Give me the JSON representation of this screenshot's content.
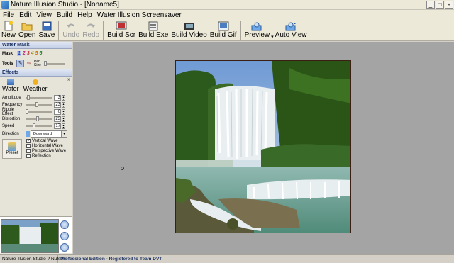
{
  "window": {
    "title": "Nature Illusion Studio - [Noname5]",
    "buttons": [
      "_",
      "□",
      "×"
    ]
  },
  "menu": [
    "File",
    "Edit",
    "View",
    "Build",
    "Help",
    "Water Illusion Screensaver"
  ],
  "toolbar": {
    "new": "New",
    "open": "Open",
    "save": "Save",
    "undo": "Undo",
    "redo": "Redo",
    "build_scr": "Build Scr",
    "build_exe": "Build Exe",
    "build_video": "Build Video",
    "build_gif": "Build Gif",
    "preview": "Preview",
    "auto_view": "Auto View"
  },
  "water_mask": {
    "header": "Water Mask",
    "mask_label": "Mask",
    "mask_numbers": [
      "1",
      "2",
      "3",
      "4",
      "5",
      "6"
    ],
    "tools_label": "Tools",
    "pen_size_label": "Pen Size"
  },
  "effects": {
    "header": "Effects",
    "tab_water": "Water",
    "tab_weather": "Weather",
    "params": [
      {
        "label": "Amplitude",
        "value": "3",
        "level": 0.05
      },
      {
        "label": "Frequency",
        "value": "23",
        "level": 0.4
      },
      {
        "label": "Ripple Effect",
        "value": "0",
        "level": 0.0
      },
      {
        "label": "Distortion",
        "value": "23",
        "level": 0.45
      },
      {
        "label": "Speed",
        "value": "17",
        "level": 0.3
      }
    ],
    "direction_label": "Direction",
    "direction_value": "Downward",
    "preset_label": "Preset",
    "checks": [
      {
        "label": "Vertical Wave",
        "checked": true
      },
      {
        "label": "Horizontal Wave",
        "checked": false
      },
      {
        "label": "Perspective Wave",
        "checked": false
      },
      {
        "label": "Reflection",
        "checked": false
      }
    ]
  },
  "status": {
    "left": "Nature Illusion Studio ? Nufsoft",
    "right": "Professional Edition - Registered to Team DVT"
  },
  "colors": {
    "canvas_bg": "#a4a4a4",
    "panel_bg": "#e6e3d8",
    "header_text": "#1a3060"
  }
}
